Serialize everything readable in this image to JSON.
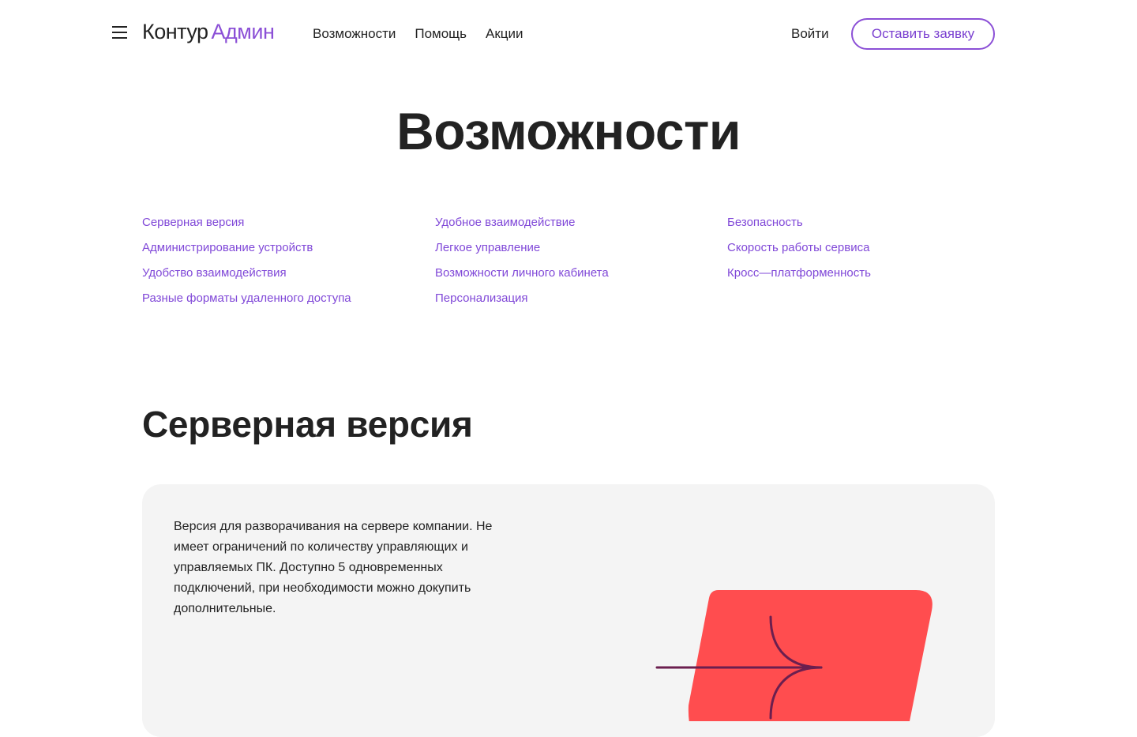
{
  "header": {
    "logo_brand": "Контур",
    "logo_product": "Админ",
    "nav": [
      "Возможности",
      "Помощь",
      "Акции"
    ],
    "login_label": "Войти",
    "cta_label": "Оставить заявку",
    "accent_color": "#8b4fd6"
  },
  "page": {
    "title": "Возможности"
  },
  "feature_links": {
    "col1": [
      "Серверная версия",
      "Администрирование устройств",
      "Удобство взаимодействия",
      "Разные форматы удаленного доступа"
    ],
    "col2": [
      "Удобное взаимодействие",
      "Легкое управление",
      "Возможности личного кабинета",
      "Персонализация"
    ],
    "col3": [
      "Безопасность",
      "Скорость работы сервиса",
      "Кросс—платформенность"
    ]
  },
  "section": {
    "title": "Серверная версия",
    "description": "Версия для разворачивания на сервере компании. Не имеет ограничений по количеству управляющих и управляемых ПК. Доступно 5 одновременных подключений, при необходимости можно докупить дополнительные.",
    "illustration_icon": "server-merge-arrow-icon",
    "illustration_color": "#ff4d4f"
  }
}
